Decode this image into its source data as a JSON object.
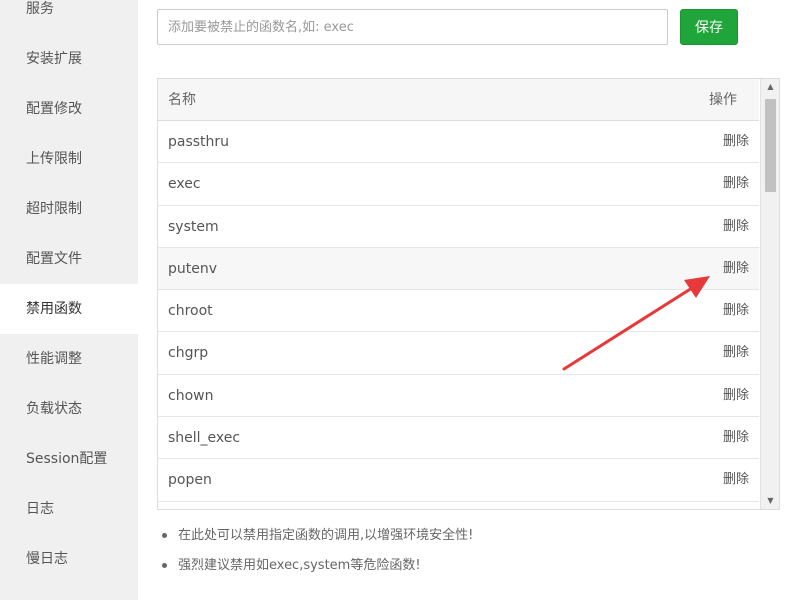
{
  "sidebar": {
    "items": [
      {
        "label": "服务",
        "active": false
      },
      {
        "label": "安装扩展",
        "active": false
      },
      {
        "label": "配置修改",
        "active": false
      },
      {
        "label": "上传限制",
        "active": false
      },
      {
        "label": "超时限制",
        "active": false
      },
      {
        "label": "配置文件",
        "active": false
      },
      {
        "label": "禁用函数",
        "active": true
      },
      {
        "label": "性能调整",
        "active": false
      },
      {
        "label": "负载状态",
        "active": false
      },
      {
        "label": "Session配置",
        "active": false
      },
      {
        "label": "日志",
        "active": false
      },
      {
        "label": "慢日志",
        "active": false
      }
    ]
  },
  "form": {
    "placeholder": "添加要被禁止的函数名,如: exec",
    "value": "",
    "save_label": "保存"
  },
  "table": {
    "col_name": "名称",
    "col_action": "操作",
    "delete_label": "删除",
    "rows": [
      "passthru",
      "exec",
      "system",
      "putenv",
      "chroot",
      "chgrp",
      "chown",
      "shell_exec",
      "popen"
    ],
    "hover_row": "putenv"
  },
  "tips": [
    "在此处可以禁用指定函数的调用,以增强环境安全性!",
    "强烈建议禁用如exec,system等危险函数!"
  ],
  "colors": {
    "accent": "#20a53a",
    "annotation": "#e8393a"
  },
  "icons": {
    "scroll_up": "triangle-up-icon",
    "scroll_down": "triangle-down-icon",
    "annotation": "red-arrow-icon"
  }
}
